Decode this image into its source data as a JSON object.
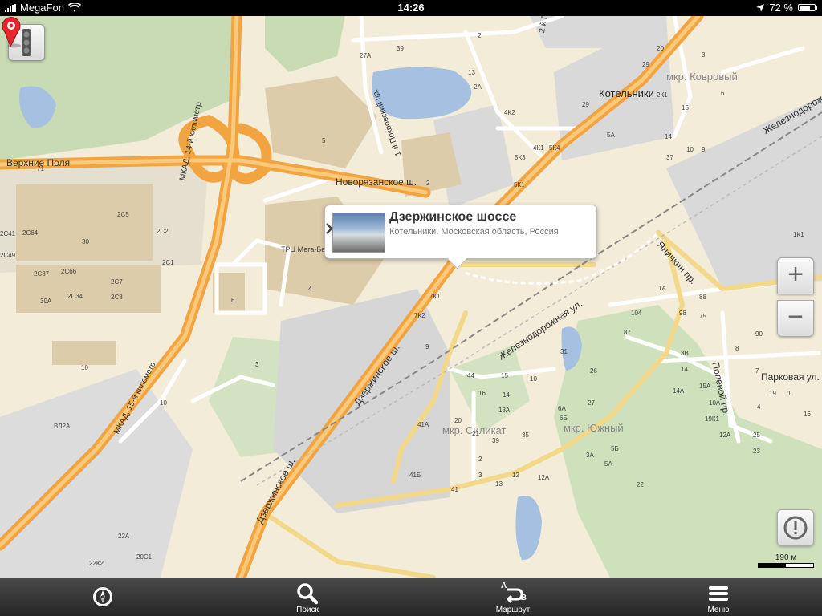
{
  "status_bar": {
    "carrier": "MegaFon",
    "time": "14:26",
    "battery": "72 %",
    "battery_level": 0.72
  },
  "callout": {
    "title": "Дзержинское шоссе",
    "subtitle": "Котельники, Московская область, Россия"
  },
  "scale": {
    "label": "190 м"
  },
  "toolbar": {
    "search": "Поиск",
    "route": "Маршрут",
    "menu": "Меню",
    "route_glyph_a": "A",
    "route_glyph_b": "B"
  },
  "map": {
    "roads": [
      "Верхние Поля",
      "МКАД, 14-й километр",
      "МКАД, 15-й километр",
      "1-й Покровский пр.",
      "2-й П",
      "Новорязанское ш.",
      "Дзержинское ш.",
      "Дзержинское ш.",
      "Железнодорожная ул.",
      "Железнодорожная ул.",
      "Яничкин пр.",
      "Полевой пр.",
      "Парковая ул."
    ],
    "districts": [
      "мкр. Ковровый",
      "мкр. Силикат",
      "мкр. Южный"
    ],
    "city": "Котельники",
    "poi": "ТРЦ Мега-Белая Дача",
    "house_numbers": [
      "71",
      "2С5",
      "2С2",
      "2С1",
      "2С41",
      "2С64",
      "2С49",
      "30",
      "2С37",
      "2С66",
      "2С7",
      "2С8",
      "30А",
      "2С34",
      "10",
      "10",
      "ВЛ2А",
      "22А",
      "20С1",
      "22К2",
      "5",
      "4",
      "6",
      "3",
      "2",
      "7К1",
      "7К2",
      "9",
      "41А",
      "41Б",
      "41",
      "31",
      "26",
      "44",
      "15",
      "10",
      "16",
      "14",
      "18А",
      "20",
      "21",
      "6А",
      "27",
      "35",
      "39",
      "6Б",
      "5Б",
      "3А",
      "5А",
      "3",
      "12",
      "12А",
      "2",
      "13",
      "15А",
      "10А",
      "19К1",
      "12А",
      "25",
      "1К1",
      "1А",
      "98",
      "88",
      "104",
      "75",
      "87",
      "3В",
      "14",
      "14А",
      "90",
      "8",
      "7",
      "19",
      "16",
      "23",
      "4",
      "1",
      "2К1",
      "29",
      "4К1",
      "5К4",
      "5К3",
      "5К1",
      "5А",
      "37",
      "15",
      "10",
      "14",
      "9",
      "6",
      "3",
      "13",
      "2А",
      "4К2",
      "2",
      "27А",
      "39",
      "20",
      "29",
      "22",
      "23"
    ]
  }
}
